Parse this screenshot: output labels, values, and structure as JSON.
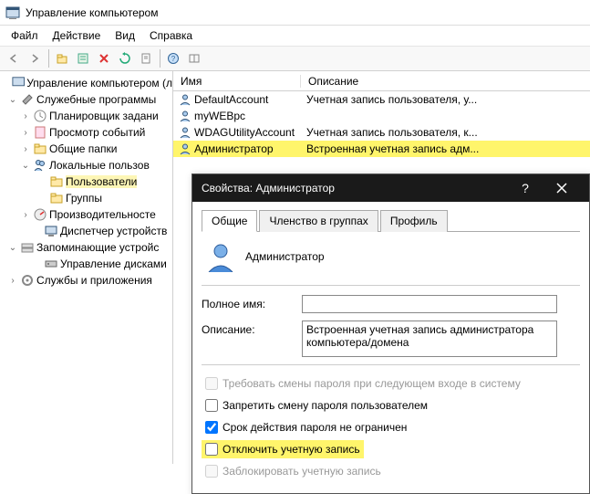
{
  "window": {
    "title": "Управление компьютером"
  },
  "menubar": {
    "file": "Файл",
    "action": "Действие",
    "view": "Вид",
    "help": "Справка"
  },
  "tree": {
    "root": "Управление компьютером (л",
    "system_tools": "Служебные программы",
    "task_scheduler": "Планировщик задани",
    "event_viewer": "Просмотр событий",
    "shared_folders": "Общие папки",
    "local_users": "Локальные пользов",
    "users": "Пользователи",
    "groups": "Группы",
    "performance": "Производительносте",
    "device_mgr": "Диспетчер устройств",
    "storage": "Запоминающие устройс",
    "disk_mgmt": "Управление дисками",
    "services": "Службы и приложения"
  },
  "list": {
    "col_name": "Имя",
    "col_desc": "Описание",
    "rows": [
      {
        "name": "DefaultAccount",
        "desc": "Учетная запись пользователя, у..."
      },
      {
        "name": "myWEBpc",
        "desc": ""
      },
      {
        "name": "WDAGUtilityAccount",
        "desc": "Учетная запись пользователя, к..."
      },
      {
        "name": "Администратор",
        "desc": "Встроенная учетная запись адм..."
      }
    ]
  },
  "dialog": {
    "title": "Свойства: Администратор",
    "tabs": {
      "general": "Общие",
      "membership": "Членство в группах",
      "profile": "Профиль"
    },
    "userlabel": "Администратор",
    "fullname_label": "Полное имя:",
    "fullname_value": "",
    "desc_label": "Описание:",
    "desc_value": "Встроенная учетная запись администратора компьютера/домена",
    "chk_must_change": "Требовать смены пароля при следующем входе в систему",
    "chk_cant_change": "Запретить смену пароля пользователем",
    "chk_never_expires": "Срок действия пароля не ограничен",
    "chk_disable": "Отключить учетную запись",
    "chk_locked": "Заблокировать учетную запись"
  }
}
